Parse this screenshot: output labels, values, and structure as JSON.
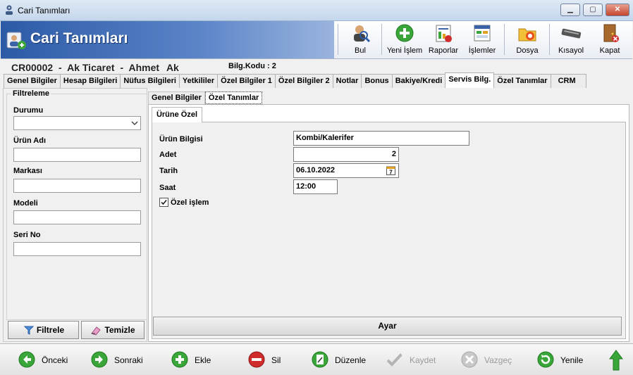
{
  "window": {
    "title": "Cari Tanımları",
    "controls": [
      "minimize",
      "maximize",
      "close"
    ]
  },
  "banner": {
    "title": "Cari Tanımları",
    "toolbar": [
      {
        "label": "Bul",
        "icon": "search-user-icon"
      },
      {
        "label": "Yeni İşlem",
        "icon": "plus-icon"
      },
      {
        "label": "Raporlar",
        "icon": "report-icon"
      },
      {
        "label": "İşlemler",
        "icon": "operations-icon"
      },
      {
        "label": "Dosya",
        "icon": "folder-icon"
      },
      {
        "label": "Kısayol",
        "icon": "keyboard-icon"
      },
      {
        "label": "Kapat",
        "icon": "exit-door-icon"
      }
    ]
  },
  "record": {
    "code": "CR00002",
    "company": "Ak Ticaret",
    "first_name": "Ahmet",
    "last_name": "Ak",
    "separator": "-",
    "bilg_kodu": "Bilg.Kodu : 2"
  },
  "main_tabs": [
    "Genel Bilgiler",
    "Hesap Bilgileri",
    "Nüfus Bilgileri",
    "Yetkililer",
    "Özel Bilgiler 1",
    "Özel Bilgiler 2",
    "Notlar",
    "Bonus",
    "Bakiye/Kredi",
    "Servis Bilg.",
    "Özel Tanımlar",
    "CRM"
  ],
  "main_tab_active": "Servis Bilg.",
  "filter": {
    "legend": "Filtreleme",
    "fields": [
      {
        "label": "Durumu",
        "value": ""
      },
      {
        "label": "Ürün Adı",
        "value": ""
      },
      {
        "label": "Markası",
        "value": ""
      },
      {
        "label": "Modeli",
        "value": ""
      },
      {
        "label": "Seri No",
        "value": ""
      }
    ],
    "filter_button": "Filtrele",
    "clear_button": "Temizle"
  },
  "sub_tabs": [
    "Genel Bilgiler",
    "Özel Tanımlar"
  ],
  "sub_tab_active": "Özel Tanımlar",
  "inner_tab": "Ürüne Özel",
  "form": {
    "urun_bilgisi_label": "Ürün Bilgisi",
    "urun_bilgisi_value": "Kombi/Kalerifer",
    "adet_label": "Adet",
    "adet_value": "2",
    "tarih_label": "Tarih",
    "tarih_value": "06.10.2022",
    "saat_label": "Saat",
    "saat_value": "12:00",
    "ozel_islem_label": "Özel işlem",
    "ozel_islem_checked": true,
    "ayar_button": "Ayar"
  },
  "nav": [
    {
      "label": "Önceki",
      "icon": "arrow-left-icon",
      "enabled": true
    },
    {
      "label": "Sonraki",
      "icon": "arrow-right-icon",
      "enabled": true
    },
    {
      "label": "Ekle",
      "icon": "plus-icon",
      "enabled": true
    },
    {
      "label": "Sil",
      "icon": "minus-icon",
      "enabled": true
    },
    {
      "label": "Düzenle",
      "icon": "edit-icon",
      "enabled": true
    },
    {
      "label": "Kaydet",
      "icon": "check-icon",
      "enabled": false
    },
    {
      "label": "Vazgeç",
      "icon": "cancel-icon",
      "enabled": false
    },
    {
      "label": "Yenile",
      "icon": "refresh-icon",
      "enabled": true
    }
  ],
  "colors": {
    "banner_blue": "#2b5aa6",
    "green": "#3aa63a",
    "red": "#d02c2c"
  }
}
